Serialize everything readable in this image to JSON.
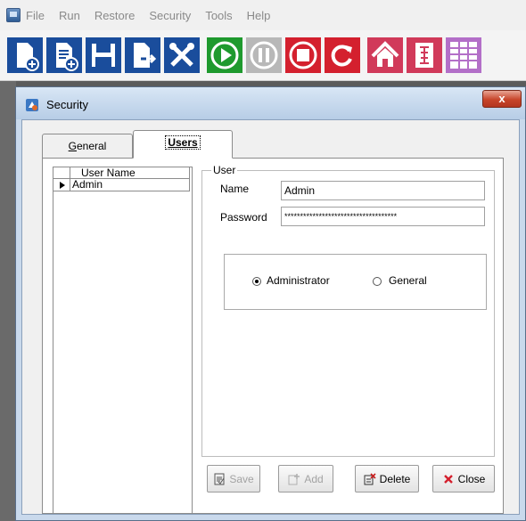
{
  "menu": {
    "items": [
      "File",
      "Run",
      "Restore",
      "Security",
      "Tools",
      "Help"
    ]
  },
  "toolbar": {
    "buttons": [
      "new-document",
      "new-document-alt",
      "save",
      "export",
      "tools",
      "run",
      "pause",
      "stop",
      "refresh",
      "home",
      "info",
      "grid"
    ]
  },
  "colors": {
    "toolbar_blue": "#1a4d9c",
    "run_green": "#1f9a2e",
    "stop_red": "#d4202e",
    "home_red": "#d13a5a",
    "disabled_gray": "#b8b8b8"
  },
  "dialog": {
    "title": "Security",
    "close_label": "x"
  },
  "tabs": {
    "general_label_prefix": "",
    "general_label_underline": "G",
    "general_label_rest": "eneral",
    "users_label_underline": "U",
    "users_label_rest": "sers",
    "active": "Users"
  },
  "grid": {
    "column_header": "User Name",
    "rows": [
      "Admin"
    ],
    "selected_row": 0
  },
  "user": {
    "group_label": "User",
    "name_label": "Name",
    "name_value": "Admin",
    "password_label": "Password",
    "password_value": "************************************",
    "role_selected": "Administrator",
    "role_options": [
      "Administrator",
      "General"
    ]
  },
  "buttons": {
    "save": "Save",
    "add": "Add",
    "delete": "Delete",
    "close": "Close"
  }
}
